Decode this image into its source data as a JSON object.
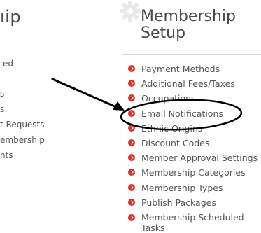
{
  "left_panel": {
    "title": "ıip",
    "items": [
      "ːed",
      "s",
      "s",
      "t Requests",
      "embership",
      "nts"
    ]
  },
  "right_panel": {
    "title_line1": "Membership",
    "title_line2": "Setup",
    "icon": "gear-icon",
    "bullet_icon": "chevron-circle-right-icon",
    "bullet_color": "#d6322b",
    "items": [
      "Payment Methods",
      "Additional Fees/Taxes",
      "Occupations",
      "Email Notifications",
      "Ethnic Origins",
      "Discount Codes",
      "Member Approval Settings",
      "Membership Categories",
      "Membership Types",
      "Publish Packages",
      "Membership Scheduled Tasks"
    ]
  },
  "annotation": {
    "type": "arrow-and-ellipse",
    "highlights": "Email Notifications",
    "color": "#000000"
  }
}
